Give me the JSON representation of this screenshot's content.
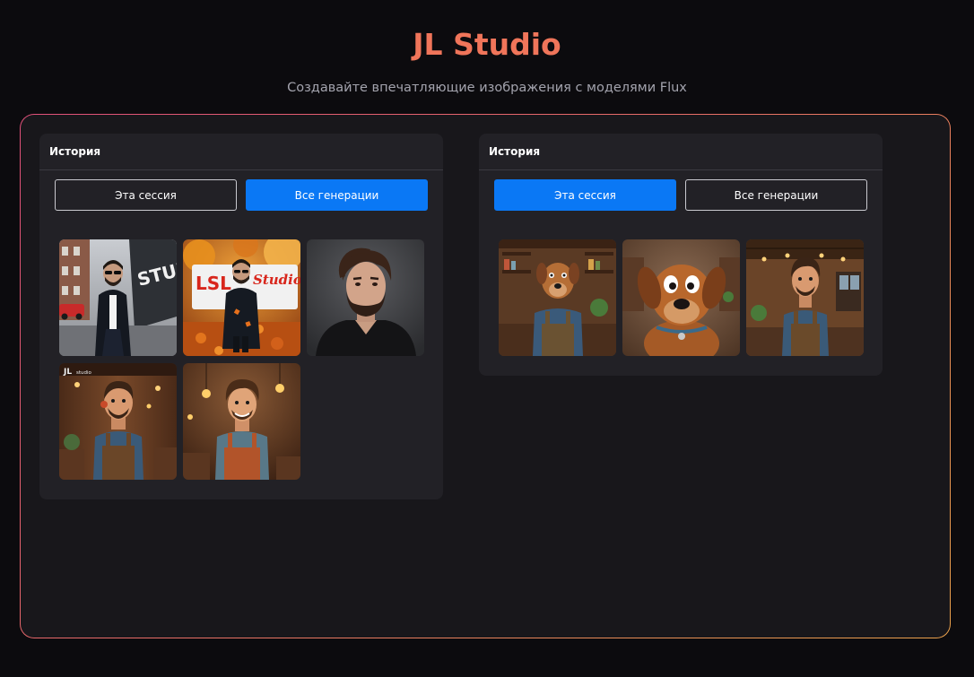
{
  "header": {
    "title": "JL Studio",
    "subtitle": "Создавайте впечатляющие изображения с моделями Flux"
  },
  "left_panel": {
    "title": "История",
    "tabs": [
      {
        "label": "Эта сессия",
        "active": false
      },
      {
        "label": "Все генерации",
        "active": true
      }
    ],
    "images": [
      {
        "icon": "man-street-photo"
      },
      {
        "icon": "man-autumn-photo"
      },
      {
        "icon": "man-portrait-photo"
      },
      {
        "icon": "cartoon-barista-photo"
      },
      {
        "icon": "cartoon-barista-photo"
      }
    ],
    "overlay_texts": {
      "studio_sign": "STUDIO",
      "lsl_sign": "LSL",
      "studios_script": "Studios",
      "jl_logo": "JL",
      "jl_logo_small": "studio"
    }
  },
  "right_panel": {
    "title": "История",
    "tabs": [
      {
        "label": "Эта сессия",
        "active": true
      },
      {
        "label": "Все генерации",
        "active": false
      }
    ],
    "images": [
      {
        "icon": "cartoon-dog-man-photo"
      },
      {
        "icon": "cartoon-dog-photo"
      },
      {
        "icon": "cartoon-barista-photo"
      }
    ]
  },
  "colors": {
    "background": "#0c0b0e",
    "frame_fill": "#18171b",
    "panel": "#222126",
    "accent_title": "#f0755a",
    "active_tab": "#0a78f5"
  }
}
